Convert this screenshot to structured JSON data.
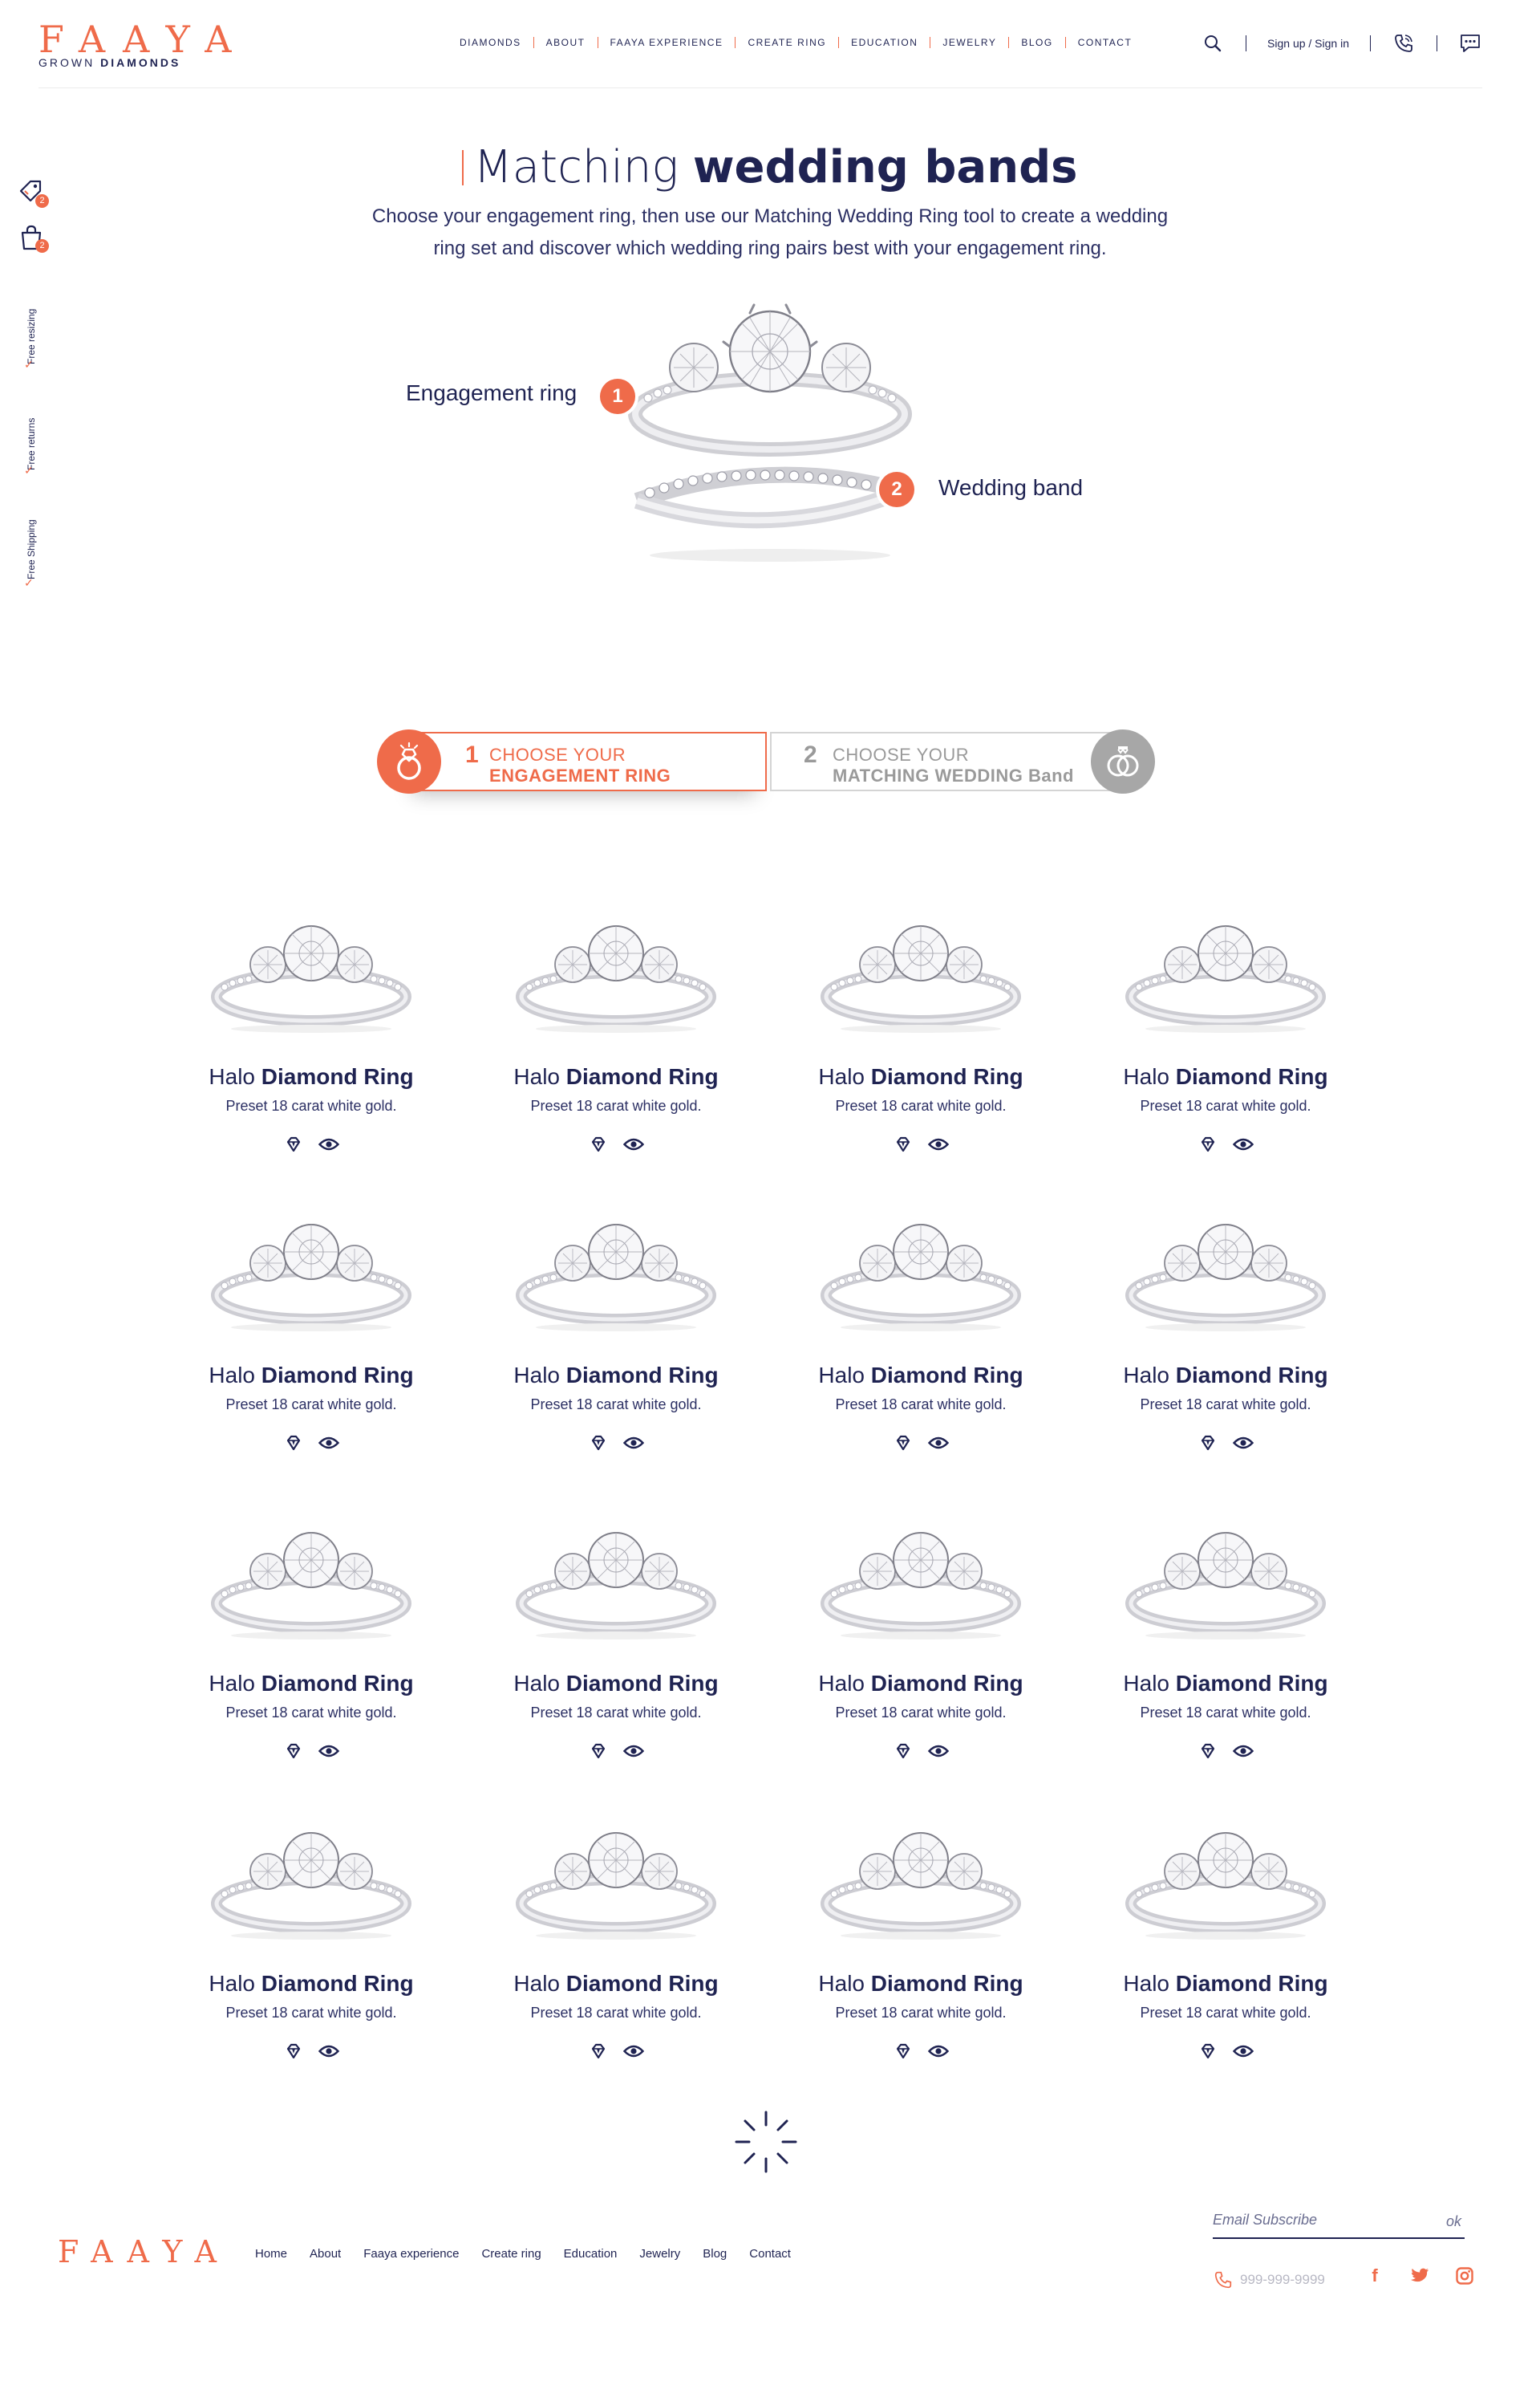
{
  "brand": {
    "name": "FAAYA",
    "sub_light": "GROWN",
    "sub_bold": "DIAMONDS"
  },
  "nav": [
    "Diamonds",
    "About",
    "Faaya experience",
    "Create ring",
    "Education",
    "Jewelry",
    "Blog",
    "Contact"
  ],
  "header": {
    "signin": "Sign up / Sign in"
  },
  "sidebar": {
    "wishlist_count": "2",
    "cart_count": "2",
    "perks": [
      "Free resizing",
      "Free returns",
      "Free Shipping"
    ]
  },
  "hero": {
    "title_light": "Matching ",
    "title_bold": "wedding bands",
    "description": "Choose your engagement ring, then use our Matching Wedding Ring tool to create a wedding ring set and discover which wedding ring pairs best with your engagement ring.",
    "engagement_label": "Engagement ring",
    "engagement_num": "1",
    "band_label": "Wedding band",
    "band_num": "2"
  },
  "steps": [
    {
      "num": "1",
      "line1": "CHOOSE YOUR",
      "line2": "ENGAGEMENT RING"
    },
    {
      "num": "2",
      "line1": "CHOOSE YOUR",
      "line2": "MATCHING WEDDING Band"
    }
  ],
  "products": [
    {
      "title_light": "Halo ",
      "title_bold": "Diamond Ring",
      "subtitle": "Preset 18 carat white gold."
    },
    {
      "title_light": "Halo ",
      "title_bold": "Diamond Ring",
      "subtitle": "Preset 18 carat white gold."
    },
    {
      "title_light": "Halo ",
      "title_bold": "Diamond Ring",
      "subtitle": "Preset 18 carat white gold."
    },
    {
      "title_light": "Halo ",
      "title_bold": "Diamond Ring",
      "subtitle": "Preset 18 carat white gold."
    },
    {
      "title_light": "Halo ",
      "title_bold": "Diamond Ring",
      "subtitle": "Preset 18 carat white gold."
    },
    {
      "title_light": "Halo ",
      "title_bold": "Diamond Ring",
      "subtitle": "Preset 18 carat white gold."
    },
    {
      "title_light": "Halo ",
      "title_bold": "Diamond Ring",
      "subtitle": "Preset 18 carat white gold."
    },
    {
      "title_light": "Halo ",
      "title_bold": "Diamond Ring",
      "subtitle": "Preset 18 carat white gold."
    },
    {
      "title_light": "Halo ",
      "title_bold": "Diamond Ring",
      "subtitle": "Preset 18 carat white gold."
    },
    {
      "title_light": "Halo ",
      "title_bold": "Diamond Ring",
      "subtitle": "Preset 18 carat white gold."
    },
    {
      "title_light": "Halo ",
      "title_bold": "Diamond Ring",
      "subtitle": "Preset 18 carat white gold."
    },
    {
      "title_light": "Halo ",
      "title_bold": "Diamond Ring",
      "subtitle": "Preset 18 carat white gold."
    },
    {
      "title_light": "Halo ",
      "title_bold": "Diamond Ring",
      "subtitle": "Preset 18 carat white gold."
    },
    {
      "title_light": "Halo ",
      "title_bold": "Diamond Ring",
      "subtitle": "Preset 18 carat white gold."
    },
    {
      "title_light": "Halo ",
      "title_bold": "Diamond Ring",
      "subtitle": "Preset 18 carat white gold."
    },
    {
      "title_light": "Halo ",
      "title_bold": "Diamond Ring",
      "subtitle": "Preset 18 carat white gold."
    }
  ],
  "footer": {
    "logo": "FAAYA",
    "nav": [
      "Home",
      "About",
      "Faaya experience",
      "Create ring",
      "Education",
      "Jewelry",
      "Blog",
      "Contact"
    ],
    "subscribe_placeholder": "Email Subscribe",
    "subscribe_button": "ok",
    "phone": "999-999-9999",
    "social": [
      "facebook-icon",
      "twitter-icon",
      "instagram-icon"
    ]
  },
  "colors": {
    "accent": "#ef6b4a",
    "navy": "#1f2352",
    "muted": "#a7a7a7"
  }
}
